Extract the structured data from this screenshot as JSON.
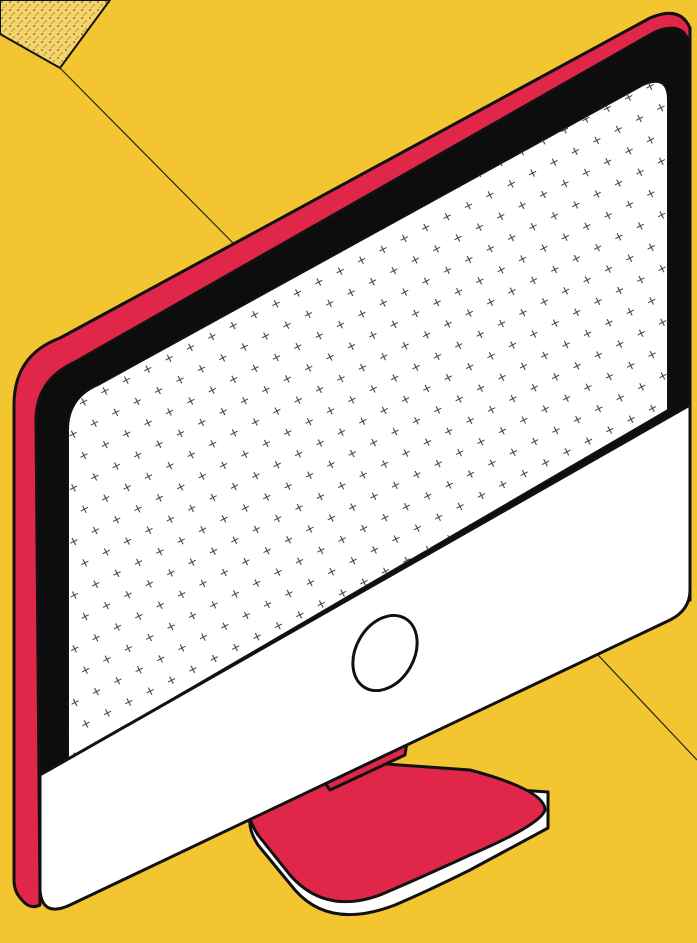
{
  "illustration": {
    "subject": "monitor-icon",
    "colors": {
      "background": "#f2c531",
      "bezel_accent": "#e0274a",
      "bezel_inner": "#0d0d0d",
      "screen": "#ffffff",
      "screen_pattern": "#444444",
      "chin": "#ffffff",
      "stand": "#e0274a",
      "outline": "#111111",
      "paper_speckle": "#f5d56a"
    }
  }
}
